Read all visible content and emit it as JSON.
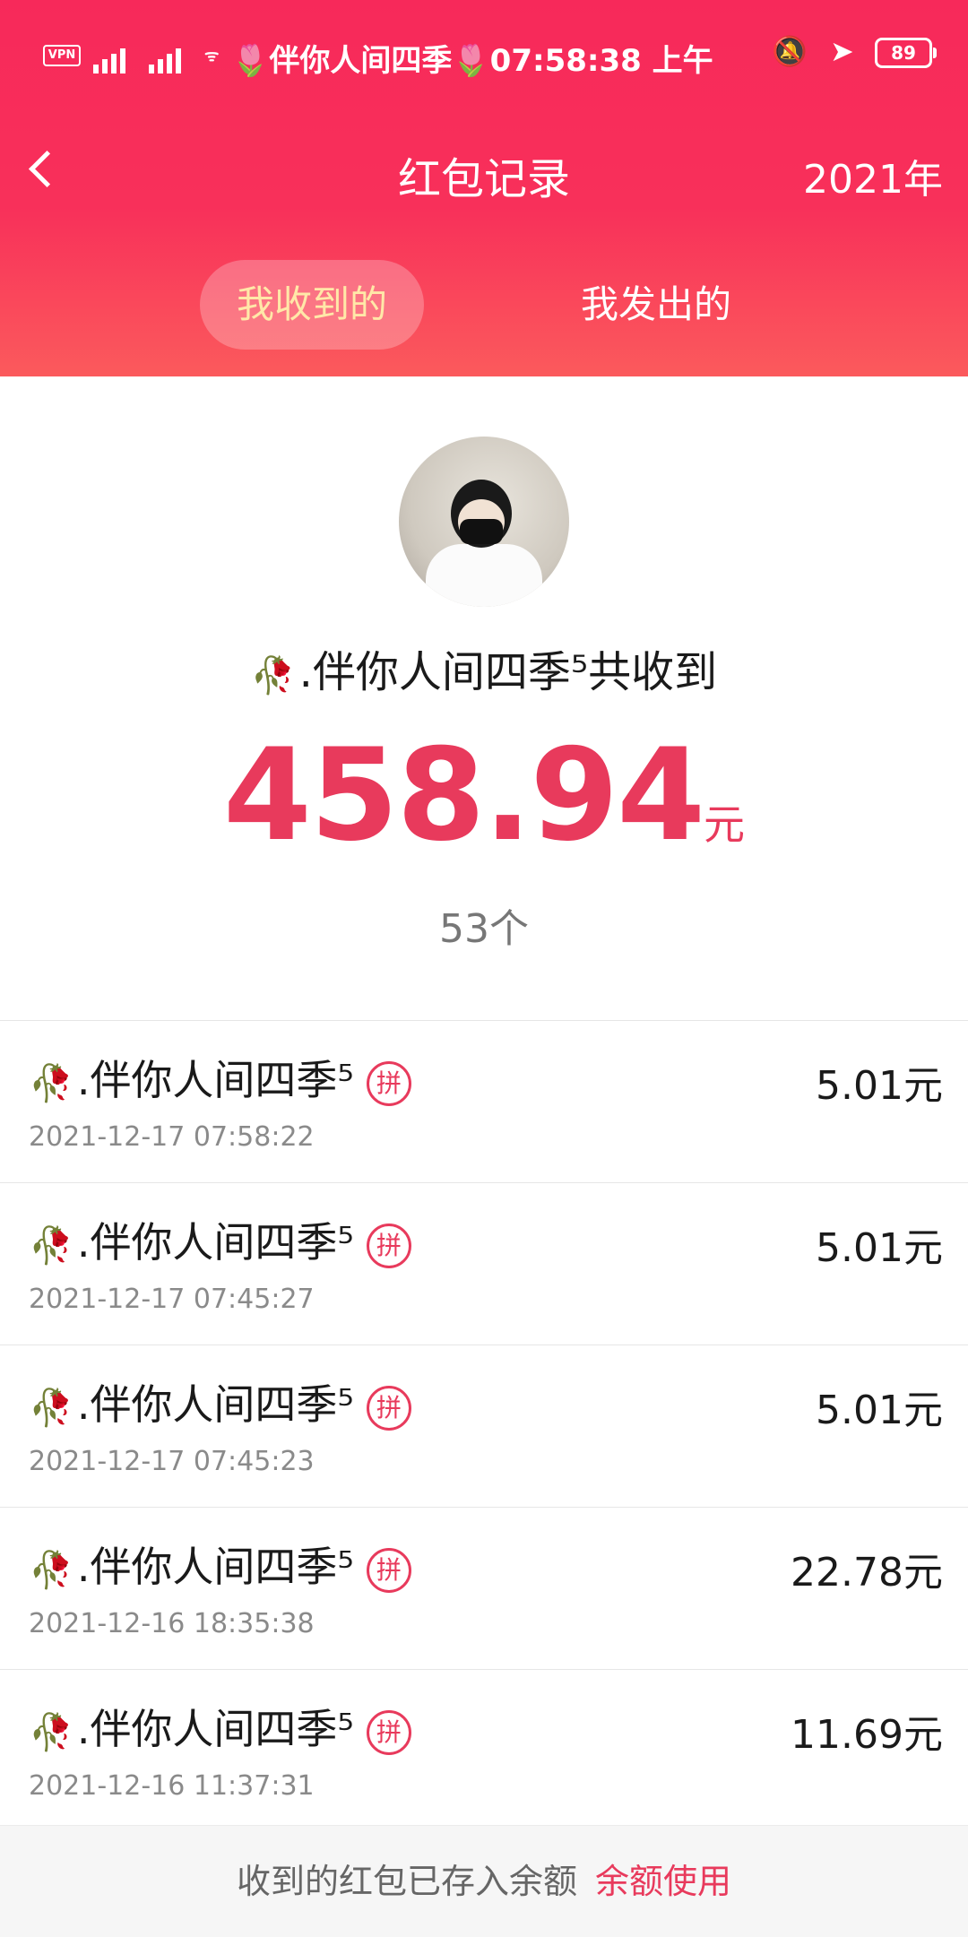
{
  "status_bar": {
    "vpn": "VPN",
    "title": "🌷伴你人间四季🌷07:58:38 上午",
    "battery": "89"
  },
  "header": {
    "title": "红包记录",
    "year": "2021年",
    "tabs": [
      {
        "label": "我收到的",
        "active": true
      },
      {
        "label": "我发出的",
        "active": false
      }
    ]
  },
  "summary": {
    "name_prefix": "🥀",
    "name": ".伴你人间四季⁵共收到",
    "amount": "458.94",
    "unit": "元",
    "count": "53个"
  },
  "records": [
    {
      "name": ".伴你人间四季⁵",
      "tag": "拼",
      "time": "2021-12-17 07:58:22",
      "amount": "5.01元"
    },
    {
      "name": ".伴你人间四季⁵",
      "tag": "拼",
      "time": "2021-12-17 07:45:27",
      "amount": "5.01元"
    },
    {
      "name": ".伴你人间四季⁵",
      "tag": "拼",
      "time": "2021-12-17 07:45:23",
      "amount": "5.01元"
    },
    {
      "name": ".伴你人间四季⁵",
      "tag": "拼",
      "time": "2021-12-16 18:35:38",
      "amount": "22.78元"
    },
    {
      "name": ".伴你人间四季⁵",
      "tag": "拼",
      "time": "2021-12-16 11:37:31",
      "amount": "11.69元"
    }
  ],
  "footer": {
    "text": "收到的红包已存入余额",
    "link": "余额使用"
  },
  "colors": {
    "accent": "#e83a5c",
    "header": "#f7295a"
  }
}
